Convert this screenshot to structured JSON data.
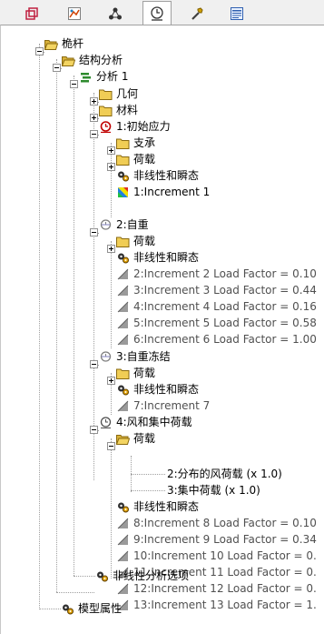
{
  "tabs": [
    {
      "name": "model-tab-icon"
    },
    {
      "name": "results-tab-icon"
    },
    {
      "name": "connections-tab-icon"
    },
    {
      "name": "analysis-tab-icon",
      "active": true
    },
    {
      "name": "tools-tab-icon"
    },
    {
      "name": "report-tab-icon"
    }
  ],
  "tree": {
    "root": "桅杆",
    "structural_analysis": "结构分析",
    "analysis1": "分析 1",
    "geometry": "几何",
    "material": "材料",
    "initial_stress": "1:初始应力",
    "support": "支承",
    "loads_1": "荷载",
    "nonlinear_1": "非线性和瞬态",
    "inc_1": "1:Increment 1",
    "self_weight": "2:自重",
    "loads_2": "荷载",
    "nonlinear_2": "非线性和瞬态",
    "inc_2": "2:Increment 2 Load Factor = 0.10",
    "inc_3": "3:Increment 3 Load Factor = 0.44",
    "inc_4": "4:Increment 4 Load Factor = 0.16",
    "inc_5": "5:Increment 5 Load Factor = 0.58",
    "inc_6": "6:Increment 6 Load Factor = 1.00",
    "freeze": "3:自重冻结",
    "loads_3": "荷载",
    "nonlinear_3": "非线性和瞬态",
    "inc_7": "7:Increment 7",
    "wind_point": "4:风和集中荷载",
    "loads_4": "荷载",
    "wind_load": "2:分布的风荷载 (x 1.0)",
    "point_load": "3:集中荷载 (x 1.0)",
    "nonlinear_4": "非线性和瞬态",
    "inc_8": "8:Increment 8 Load Factor = 0.10",
    "inc_9": "9:Increment 9 Load Factor = 0.34",
    "inc_10": "10:Increment 10 Load Factor = 0.",
    "inc_11": "11:Increment 11 Load Factor = 0.",
    "inc_12": "12:Increment 12 Load Factor = 0.",
    "inc_13": "13:Increment 13 Load Factor = 1.",
    "nonlinear_options": "非线性分析选项",
    "model_properties": "模型属性"
  },
  "colors": {
    "folder": "#e8c94a",
    "folder_dark": "#b8962a",
    "accent_red": "#c00000",
    "green": "#2e8b2e",
    "blue": "#2050c0"
  }
}
